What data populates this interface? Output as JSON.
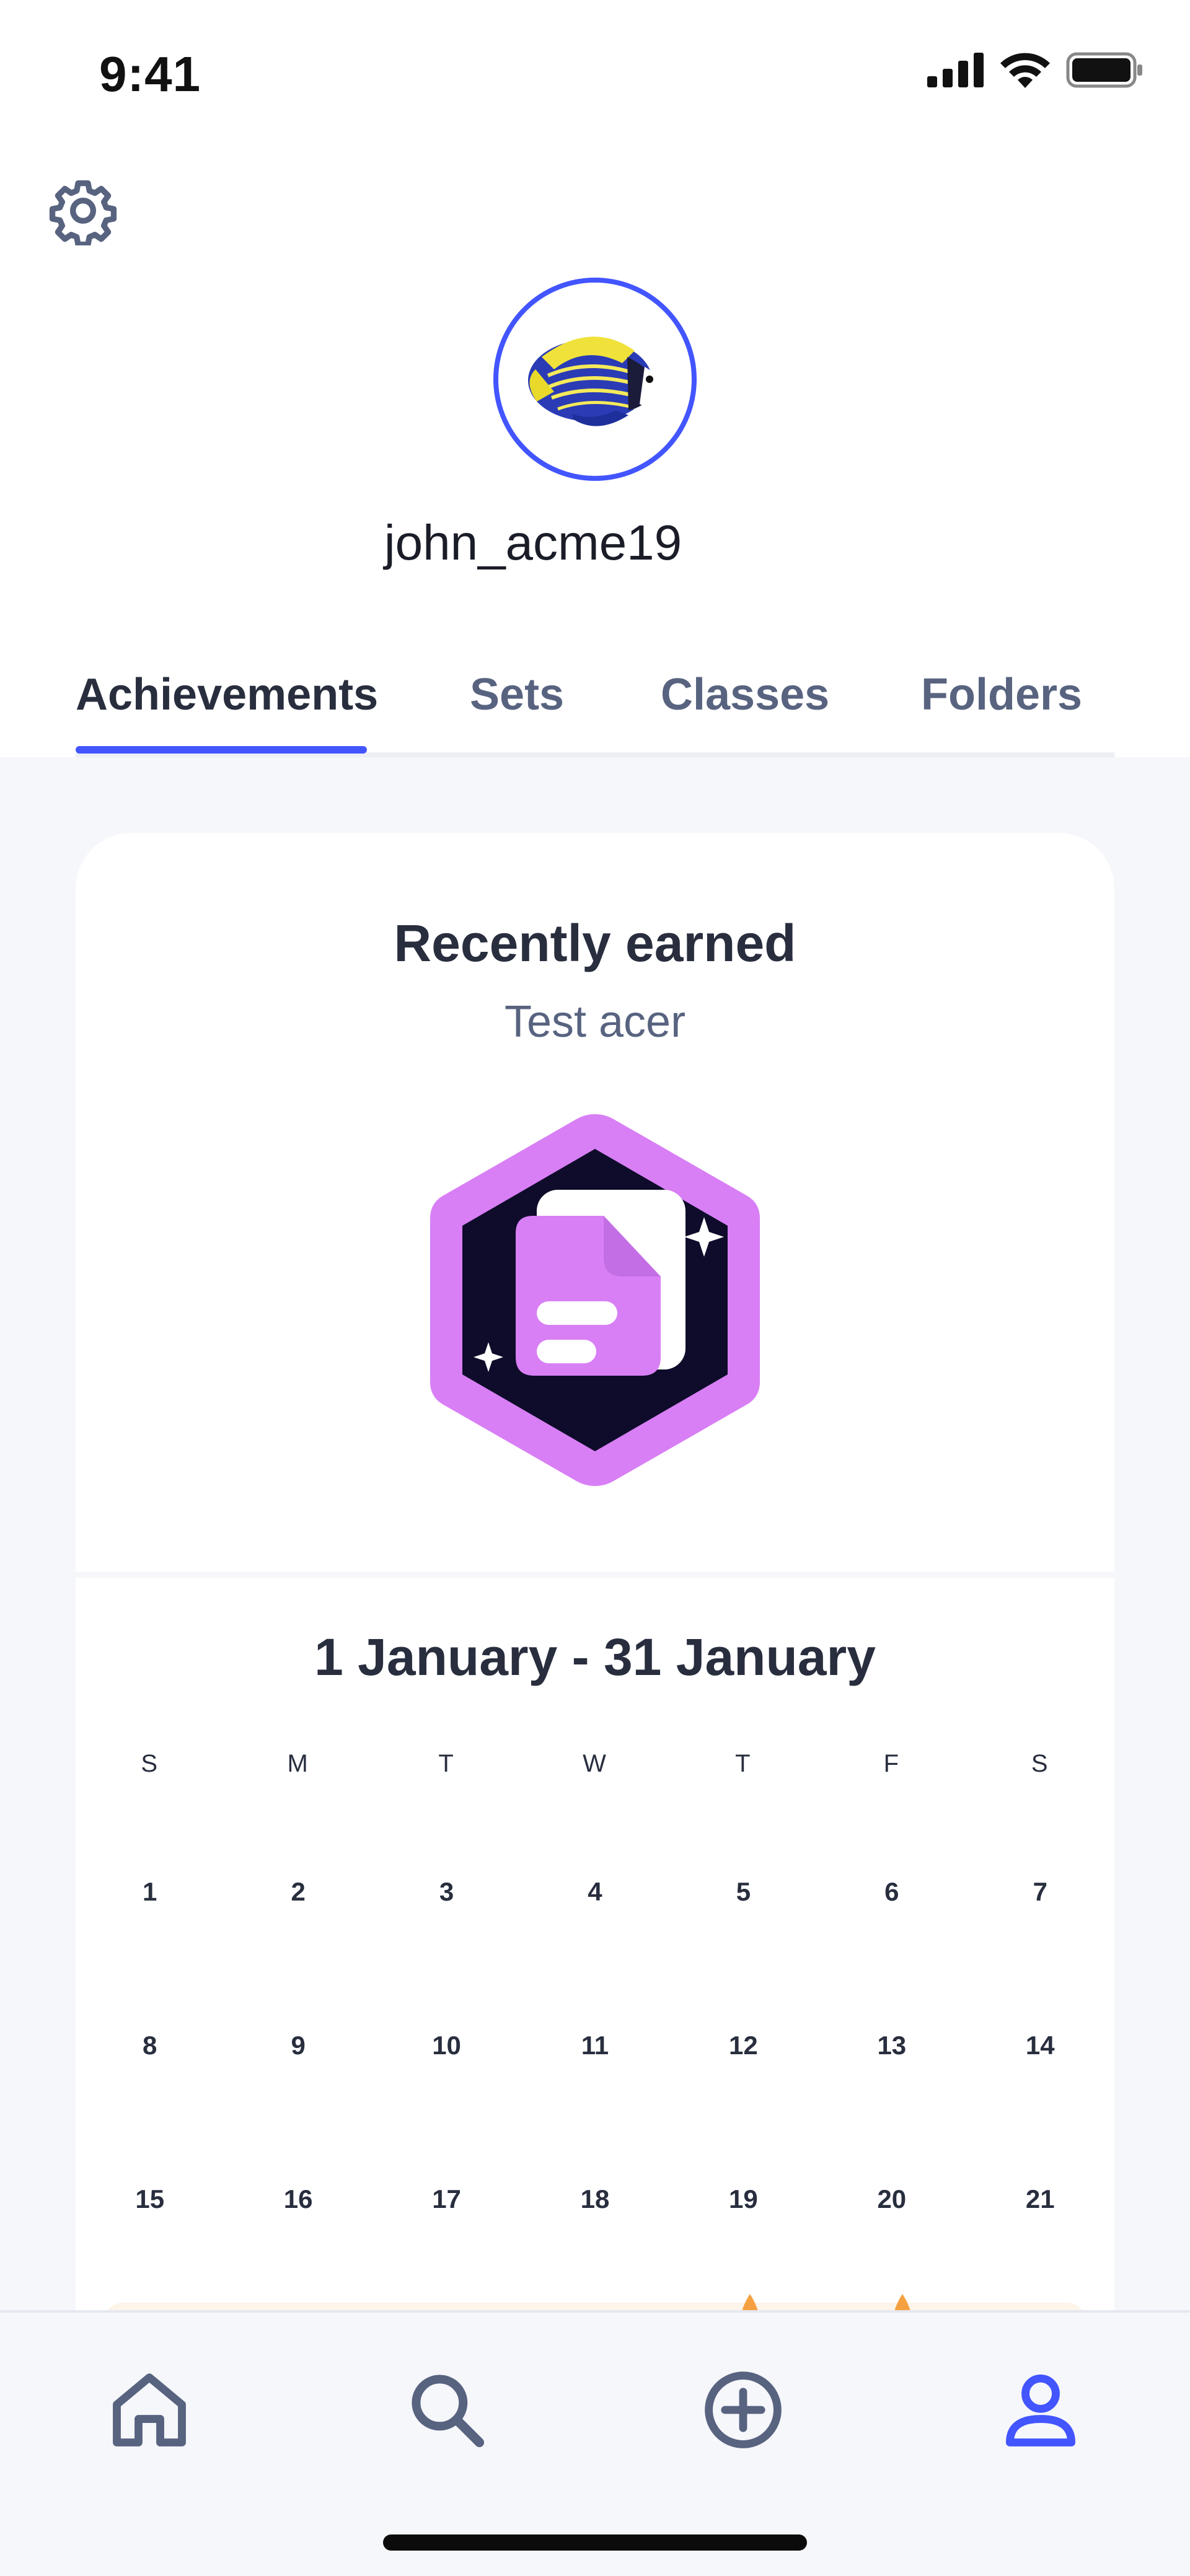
{
  "status_bar": {
    "time": "9:41"
  },
  "profile": {
    "username": "john_acme19"
  },
  "tabs": [
    {
      "label": "Achievements",
      "active": true
    },
    {
      "label": "Sets",
      "active": false
    },
    {
      "label": "Classes",
      "active": false
    },
    {
      "label": "Folders",
      "active": false
    }
  ],
  "achievements": {
    "title": "Recently earned",
    "badge_name": "Test acer",
    "badge_icon": "document-stack-badge-icon"
  },
  "calendar": {
    "range": "1 January - 31 January",
    "weekdays": [
      "S",
      "M",
      "T",
      "W",
      "T",
      "F",
      "S"
    ],
    "weeks": [
      [
        "1",
        "2",
        "3",
        "4",
        "5",
        "6",
        "7"
      ],
      [
        "8",
        "9",
        "10",
        "11",
        "12",
        "13",
        "14"
      ],
      [
        "15",
        "16",
        "17",
        "18",
        "19",
        "20",
        "21"
      ]
    ]
  },
  "nav": {
    "items": [
      "home-icon",
      "search-icon",
      "create-icon",
      "profile-icon"
    ],
    "active": "profile-icon"
  },
  "colors": {
    "accent": "#4255ff",
    "badge": "#d87ff5",
    "badge_dark": "#0e0c2a",
    "text_secondary": "#586380"
  }
}
